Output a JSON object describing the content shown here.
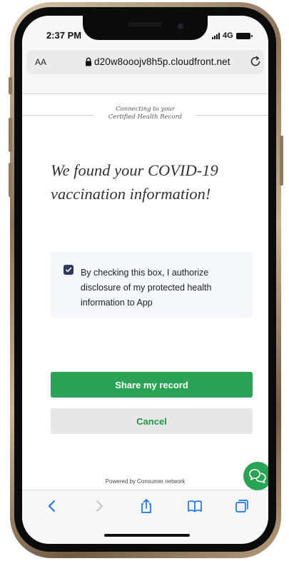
{
  "status_bar": {
    "time": "2:37 PM",
    "network": "4G"
  },
  "browser": {
    "text_size_label": "AA",
    "url": "d20w8ooojv8h5p.cloudfront.net"
  },
  "page": {
    "connecting_line1": "Connecting to your",
    "connecting_line2": "Certified Health Record",
    "headline": "We found your COVID-19 vaccination information!",
    "consent": {
      "checked": true,
      "text": "By checking this box, I authorize disclosure of my protected health information to App"
    },
    "share_label": "Share my record",
    "cancel_label": "Cancel",
    "powered_by": "Powered by Consumer network"
  },
  "colors": {
    "accent_green": "#2aa454",
    "checkbox_navy": "#2d3a5a",
    "toolbar_blue": "#1a73e8"
  },
  "toolbar": {
    "icons": [
      "back-icon",
      "forward-icon",
      "share-icon",
      "bookmarks-icon",
      "tabs-icon"
    ]
  }
}
